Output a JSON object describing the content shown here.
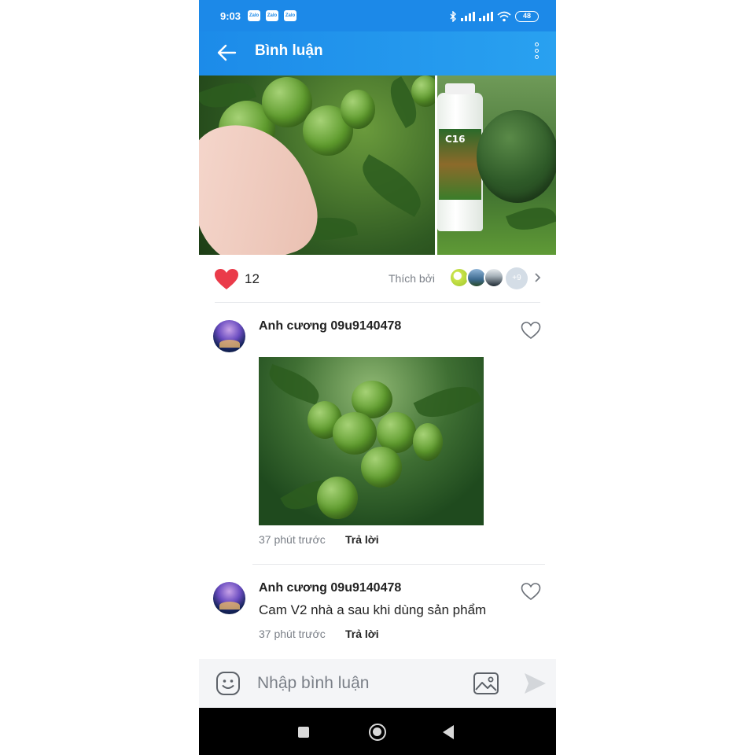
{
  "status_bar": {
    "time": "9:03",
    "notification_badges": [
      "Zalo",
      "Zalo",
      "Zalo"
    ],
    "battery": "48",
    "icons": [
      "bluetooth-icon",
      "signal-icon",
      "signal-icon",
      "wifi-icon",
      "battery-icon"
    ]
  },
  "header": {
    "title": "Bình luận",
    "back_icon": "arrow-left-icon",
    "menu_icon": "more-vertical-icon"
  },
  "post": {
    "photos": [
      "green-oranges-on-tree-held-by-hand",
      "fertilizer-bottle-and-green-orange"
    ],
    "bottle_label": "C16",
    "like_count": "12",
    "liked_by_label": "Thích bởi",
    "more_likers": "+9"
  },
  "comments": [
    {
      "author": "Anh cương 09u9140478",
      "has_photo": true,
      "time": "37 phút trước",
      "reply_label": "Trả lời"
    },
    {
      "author": "Anh cương 09u9140478",
      "text": "Cam V2 nhà a sau khi dùng sản phẩm",
      "time": "37 phút trước",
      "reply_label": "Trả lời"
    }
  ],
  "input_bar": {
    "placeholder": "Nhập bình luận",
    "value": ""
  },
  "colors": {
    "header": "#1c89e8",
    "like_heart": "#ea3b4a",
    "muted_text": "#7a7f87"
  }
}
